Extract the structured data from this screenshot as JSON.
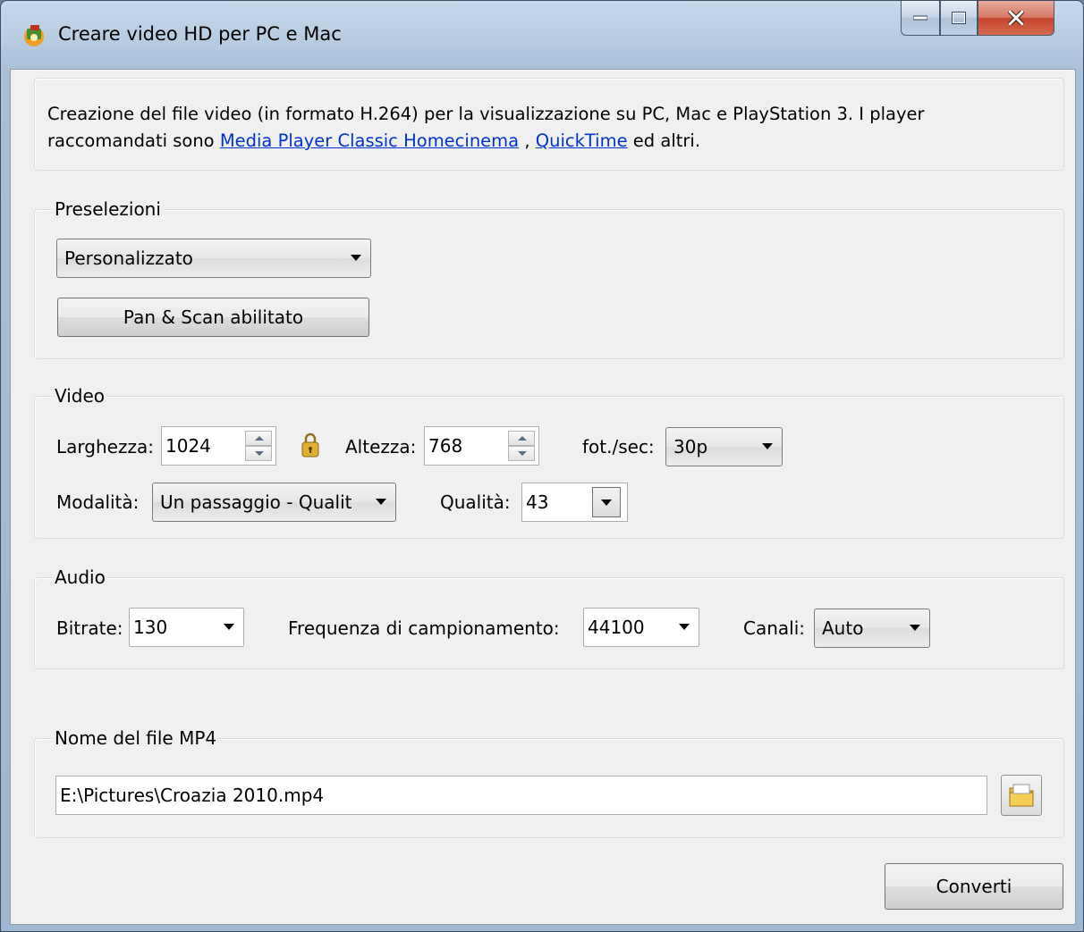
{
  "window": {
    "title": "Creare video HD per PC e Mac"
  },
  "description": {
    "text_before": "Creazione del file video (in formato H.264) per la visualizzazione su PC, Mac e PlayStation 3. I player raccomandati sono ",
    "link1": "Media Player Classic Homecinema",
    "separator": " , ",
    "link2": "QuickTime",
    "text_after": " ed altri."
  },
  "presets": {
    "legend": "Preselezioni",
    "selected": "Personalizzato",
    "pan_scan_button": "Pan & Scan abilitato"
  },
  "video": {
    "legend": "Video",
    "width_label": "Larghezza:",
    "width_value": "1024",
    "height_label": "Altezza:",
    "height_value": "768",
    "fps_label": "fot./sec:",
    "fps_value": "30p",
    "mode_label": "Modalità:",
    "mode_value": "Un passaggio - Qualit",
    "quality_label": "Qualità:",
    "quality_value": "43"
  },
  "audio": {
    "legend": "Audio",
    "bitrate_label": "Bitrate:",
    "bitrate_value": "130",
    "samplerate_label": "Frequenza di campionamento:",
    "samplerate_value": "44100",
    "channels_label": "Canali:",
    "channels_value": "Auto"
  },
  "output": {
    "legend": "Nome del file MP4",
    "filename": "E:\\Pictures\\Croazia 2010.mp4"
  },
  "convert_button": "Converti"
}
